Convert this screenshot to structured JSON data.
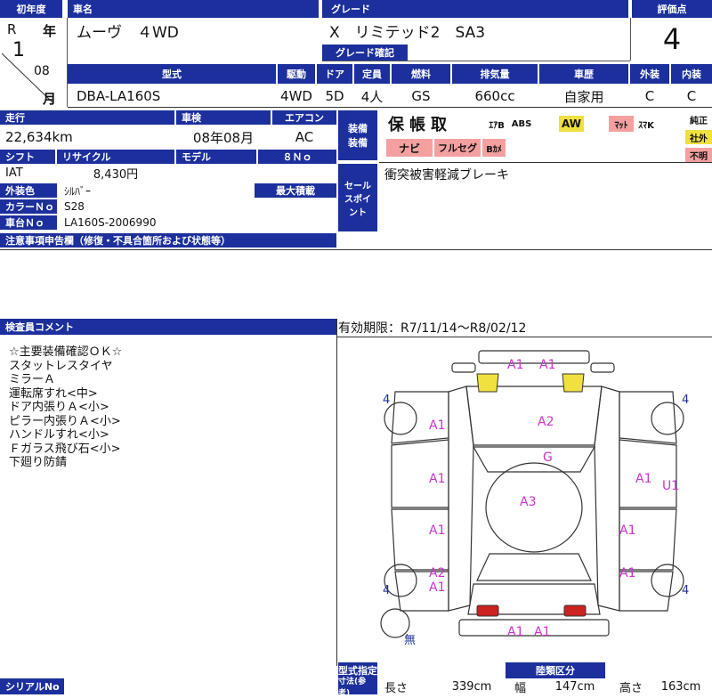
{
  "header": {
    "first_reg_label": "初年度",
    "car_name_label": "車名",
    "grade_label": "グレード",
    "score_label": "評価点",
    "era": "R",
    "year": "1",
    "year_unit": "年",
    "month": "08",
    "month_unit": "月",
    "car_name": "ムーヴ　４WD",
    "grade": "X　リミテッド2　SA3",
    "grade_confirm_label": "グレード確記",
    "score": "4"
  },
  "spec": {
    "labels": {
      "model": "型式",
      "drive": "駆動",
      "door": "ドア",
      "capacity": "定員",
      "fuel": "燃料",
      "displacement": "排気量",
      "usage": "車歴",
      "exterior": "外装",
      "interior": "内装"
    },
    "model": "DBA-LA160S",
    "drive": "4WD",
    "door": "5D",
    "capacity": "4人",
    "fuel": "GS",
    "displacement": "660cc",
    "usage": "自家用",
    "exterior": "C",
    "interior": "C"
  },
  "run": {
    "mileage_label": "走行",
    "inspection_label": "車検",
    "aircon_label": "エアコン",
    "mileage": "22,634km",
    "inspection": "08年08月",
    "aircon": "AC",
    "shift_label": "シフト",
    "recycle_label": "リサイクル",
    "model_label": "モデル",
    "eightno_label": "８Ｎｏ",
    "shift": "IAT",
    "recycle": "8,430円",
    "color_label": "外装色",
    "maxload_label": "最大積載",
    "color": "ｼﾙﾊﾞｰ",
    "color_no_label": "カラーＮｏ",
    "color_no": "S28",
    "chassis_label": "車台Ｎｏ",
    "chassis": "LA160S-2006990",
    "notes_label": "注意事項申告欄（修復・不具合箇所および状態等）"
  },
  "equipment": {
    "label_top": "装備",
    "label_bottom": "装備",
    "hosho": "保",
    "sho": "帳",
    "tori": "取",
    "airbag": "ｴｱB",
    "abs": "ABS",
    "aw": "AW",
    "mat": "ﾏｯﾄ",
    "smartkey": "ｽﾏK",
    "navi": "ナビ",
    "fullseg": "フルセグ",
    "bcam": "Bｶﾒ",
    "genuine": "純正",
    "aftermarket": "社外",
    "unknown": "不明",
    "sales_label": "セールスポイント",
    "sales_point": "衝突被害軽減ブレーキ"
  },
  "inspector": {
    "label": "検査員コメント",
    "validity": "有効期限：R7/11/14〜R8/02/12",
    "comments": [
      "☆主要装備確認ＯＫ☆",
      "スタットレスタイヤ",
      "ミラーＡ",
      "運転席すれ<中>",
      "ドア内張りＡ<小>",
      "ピラー内張りＡ<小>",
      "ハンドルすれ<小>",
      "Ｆガラス飛び石<小>",
      "下廻り防錆"
    ]
  },
  "diagram": {
    "marks": [
      "A1",
      "A1",
      "A2",
      "A1",
      "A1",
      "G",
      "A1",
      "A1",
      "A3",
      "A1",
      "A1",
      "A2",
      "A1",
      "U1",
      "A1",
      "A1"
    ],
    "tire_depths": [
      "4",
      "4",
      "4",
      "4"
    ],
    "spare_label": "無",
    "colors": {
      "yellow": "#f0e040",
      "red": "#cc2222",
      "mark": "#cc33cc",
      "navy": "#1c2f9c"
    }
  },
  "footer": {
    "serial_label": "シリアルNo",
    "type_spec_top": "型式指定",
    "type_spec_bottom": "寸法(参考)",
    "length_label": "長さ",
    "length": "339cm",
    "width_label": "幅",
    "width": "147cm",
    "height_label": "高さ",
    "height": "163cm",
    "recycle_cat_label": "陸類区分"
  }
}
